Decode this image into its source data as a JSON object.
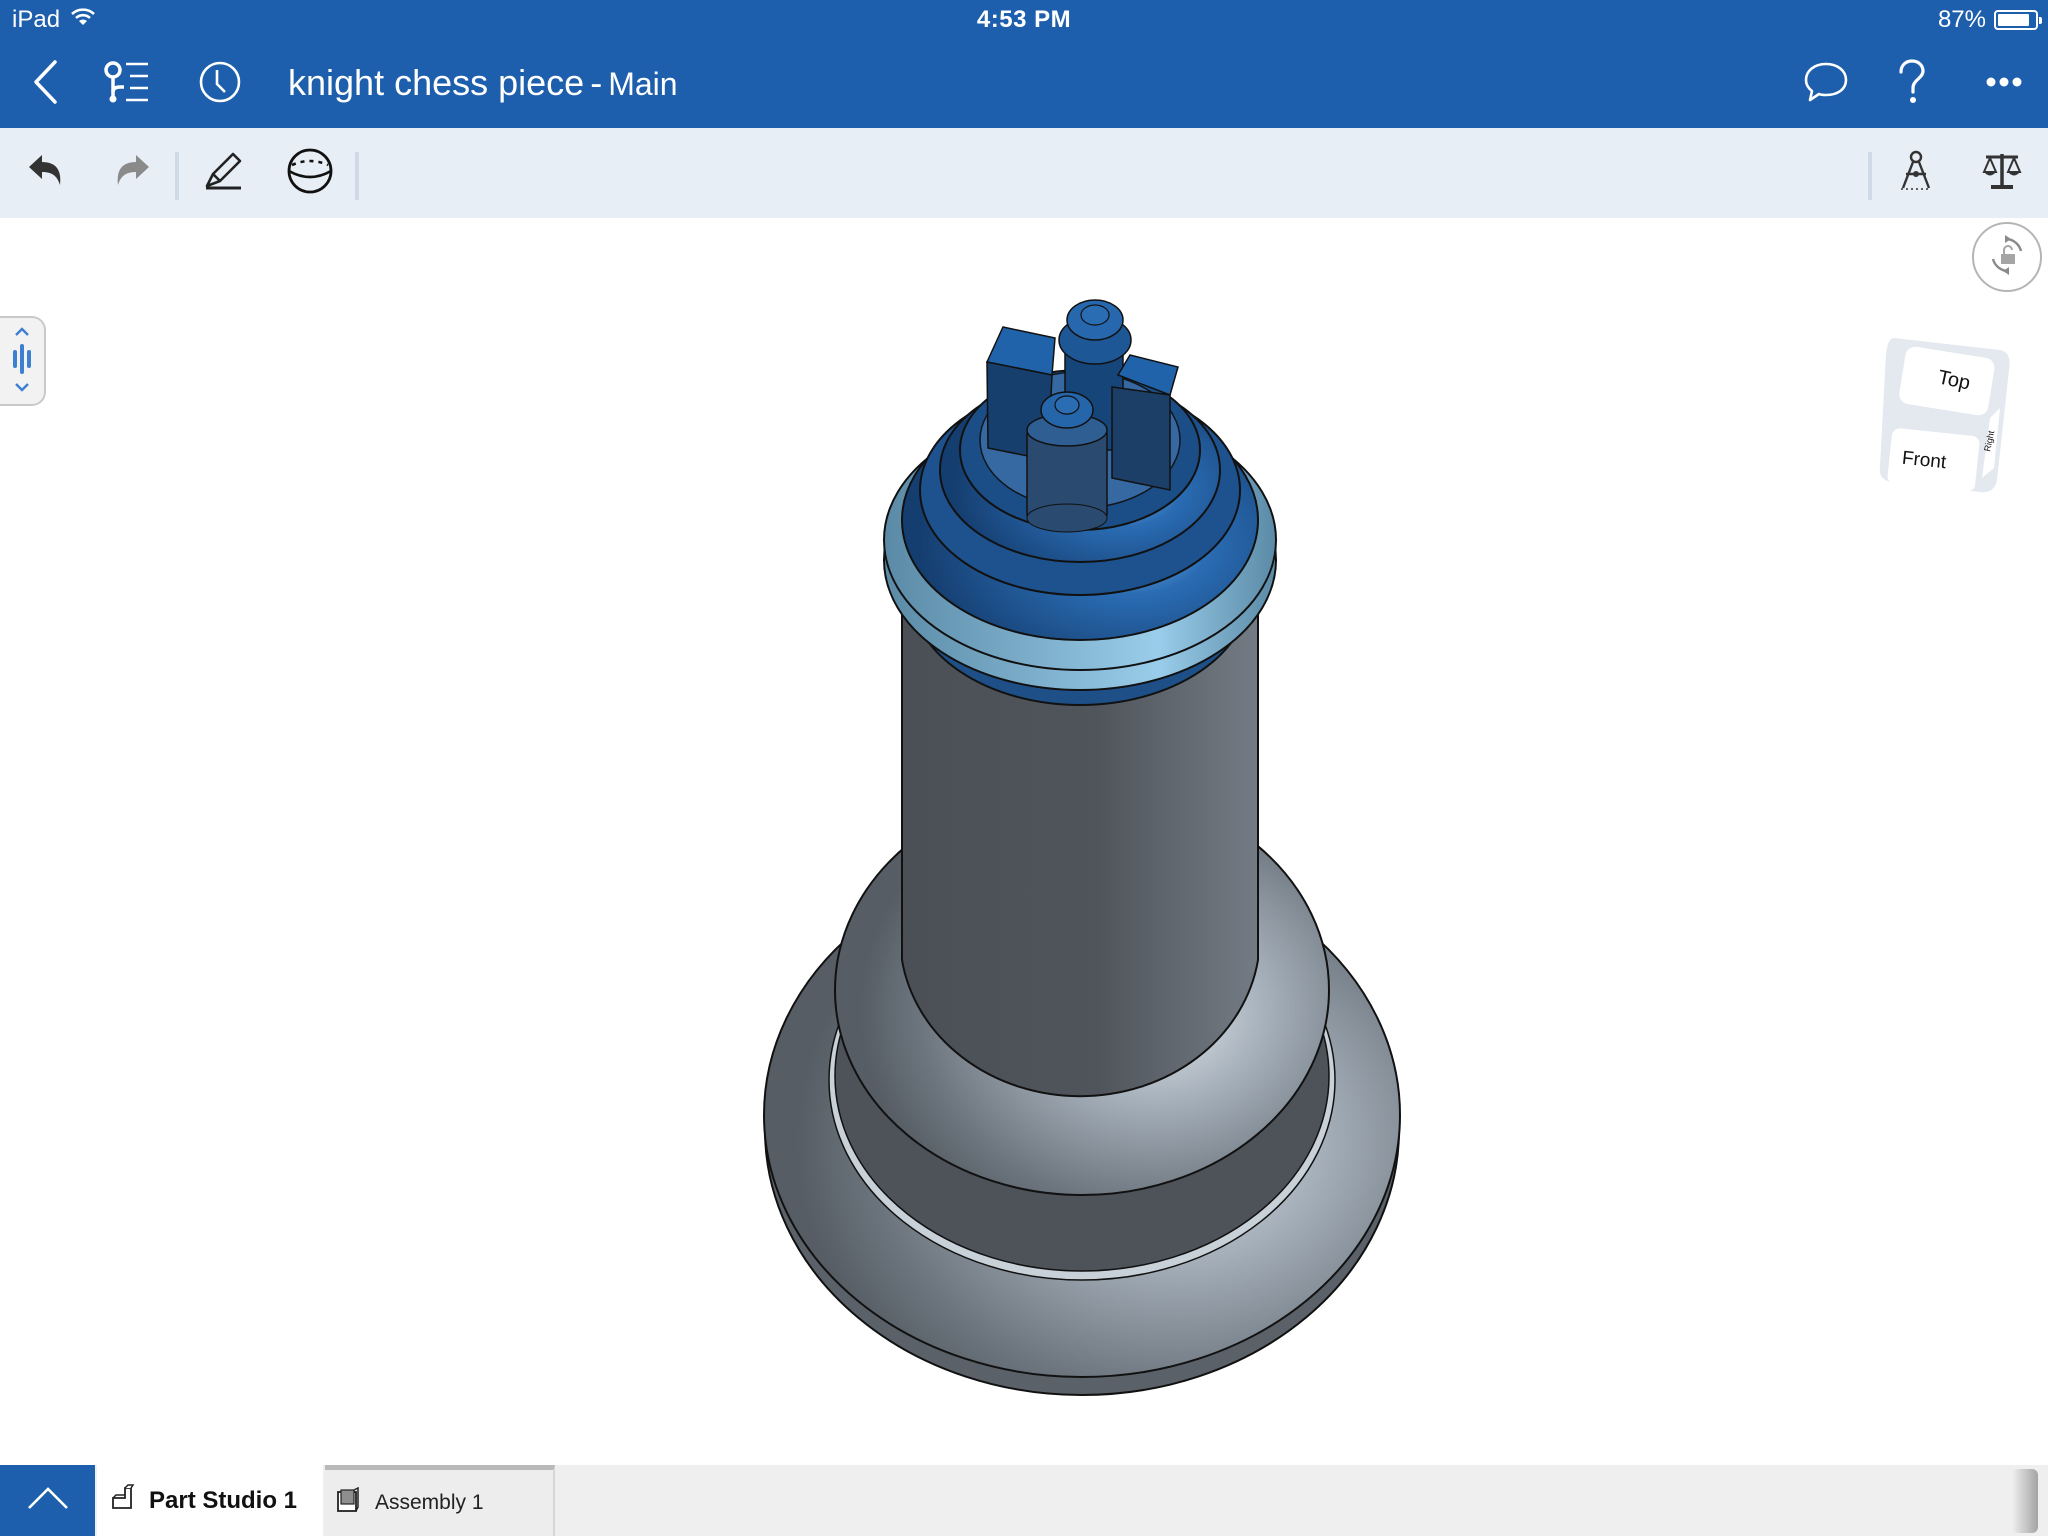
{
  "status_bar": {
    "device": "iPad",
    "wifi_icon": "wifi-icon",
    "time": "4:53 PM",
    "battery_percent_label": "87%",
    "battery_level": 0.87
  },
  "nav": {
    "back_icon": "chevron-left-icon",
    "feature_tree_icon": "feature-list-icon",
    "history_icon": "clock-icon",
    "document_name": "knight chess piece",
    "separator": "-",
    "branch": "Main",
    "comments_icon": "speech-bubble-icon",
    "help_icon": "question-mark-icon",
    "more_icon": "ellipsis-icon"
  },
  "toolbar": {
    "undo_icon": "undo-icon",
    "redo_icon": "redo-icon",
    "sketch_icon": "pencil-icon",
    "view_icon": "sphere-section-icon",
    "measure_icon": "compass-measure-icon",
    "mass_properties_icon": "balance-scale-icon"
  },
  "viewport": {
    "orbit_lock_icon": "rotation-unlock-icon",
    "view_cube": {
      "top_label": "Top",
      "front_label": "Front",
      "right_label": "Right"
    },
    "side_handle_icon": "configuration-panel-icon",
    "model_name": "knight chess piece"
  },
  "colors": {
    "brand_blue": "#1d5fad",
    "toolbar_bg": "#e8eef6",
    "selected_part_blue": "#1f5a9e",
    "body_gray": "#555b61"
  },
  "tabs": {
    "toggle_icon": "chevron-up-icon",
    "items": [
      {
        "label": "Part Studio 1",
        "icon": "part-studio-icon",
        "active": true
      },
      {
        "label": "Assembly 1",
        "icon": "assembly-icon",
        "active": false
      }
    ]
  }
}
